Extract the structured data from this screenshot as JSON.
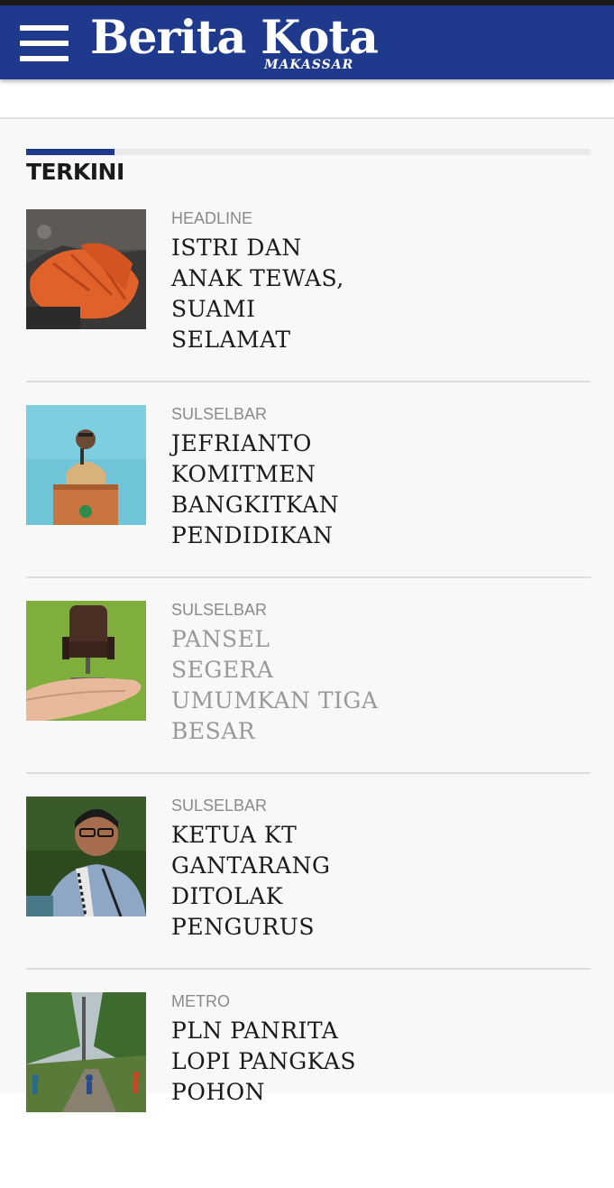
{
  "header": {
    "logo_text": "Berita Kota",
    "logo_subtext": "MAKASSAR",
    "brand_color": "#1f3a8c"
  },
  "section": {
    "title": "TERKINI"
  },
  "articles": [
    {
      "category": "HEADLINE",
      "title": "ISTRI DAN ANAK TEWAS, SUAMI SELAMAT"
    },
    {
      "category": "SULSELBAR",
      "title": "JEFRIANTO KOMITMEN BANGKITKAN PENDIDIKAN"
    },
    {
      "category": "SULSELBAR",
      "title": "PANSEL SEGERA UMUMKAN TIGA BESAR"
    },
    {
      "category": "SULSELBAR",
      "title": "KETUA KT GANTARANG DITOLAK PENGURUS"
    },
    {
      "category": "METRO",
      "title": "PLN PANRITA LOPI PANGKAS POHON"
    }
  ]
}
